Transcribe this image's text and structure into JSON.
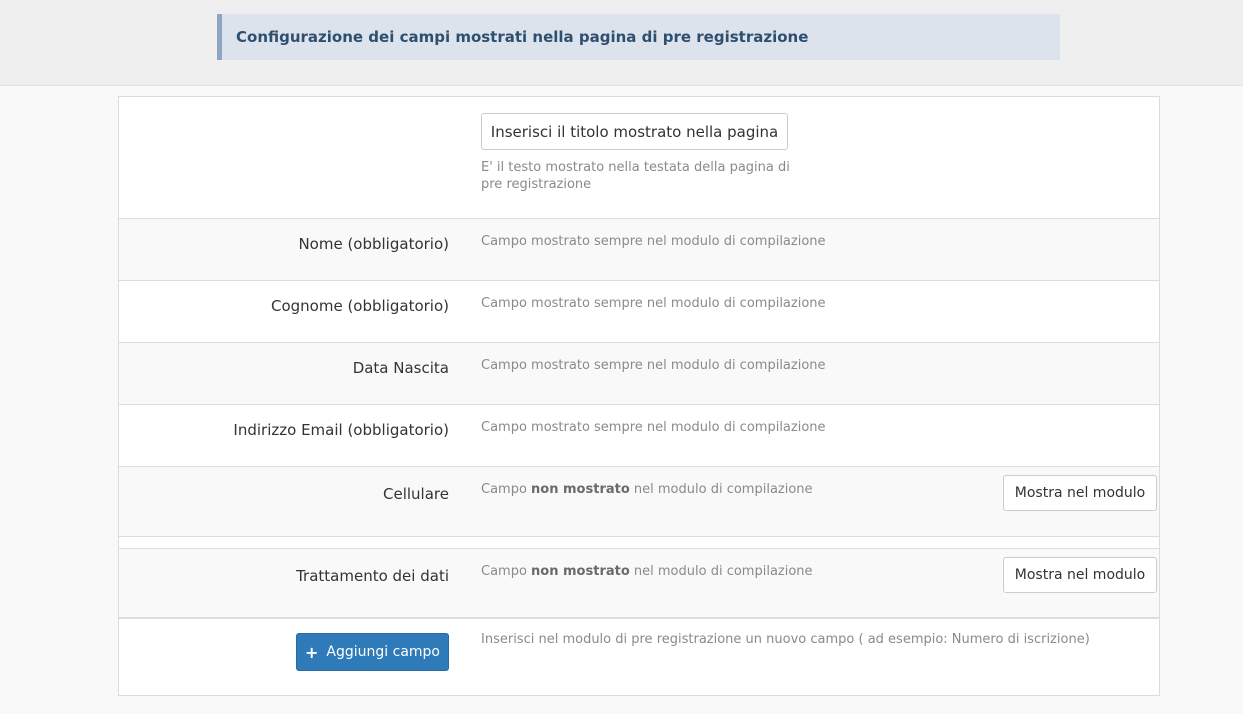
{
  "header": {
    "title": "Configurazione dei campi mostrati nella pagina di pre registrazione"
  },
  "title_section": {
    "button_label": "Inserisci il titolo mostrato nella pagina",
    "help_text": "E' il testo mostrato nella testata della pagina di pre registrazione"
  },
  "fields": [
    {
      "label": "Nome (obbligatorio)",
      "desc": "Campo mostrato sempre nel modulo di compilazione"
    },
    {
      "label": "Cognome (obbligatorio)",
      "desc": "Campo mostrato sempre nel modulo di compilazione"
    },
    {
      "label": "Data Nascita",
      "desc": "Campo mostrato sempre nel modulo di compilazione"
    },
    {
      "label": "Indirizzo Email (obbligatorio)",
      "desc": "Campo mostrato sempre nel modulo di compilazione"
    },
    {
      "label": "Cellulare",
      "desc_pre": "Campo ",
      "desc_bold": "non mostrato",
      "desc_post": " nel modulo di compilazione",
      "button": "Mostra nel modulo"
    },
    {
      "label": "Trattamento dei dati",
      "desc_pre": "Campo ",
      "desc_bold": "non mostrato",
      "desc_post": " nel modulo di compilazione",
      "button": "Mostra nel modulo"
    }
  ],
  "add_field": {
    "button_label": "Aggiungi campo",
    "icon": "plus-icon",
    "desc": "Inserisci nel modulo di pre registrazione un nuovo campo ( ad esempio: Numero di iscrizione)"
  },
  "colors": {
    "header_bg": "#dde3ec",
    "header_accent": "#8fa6c2",
    "header_text": "#2f4f70",
    "primary": "#2f7ab9"
  }
}
